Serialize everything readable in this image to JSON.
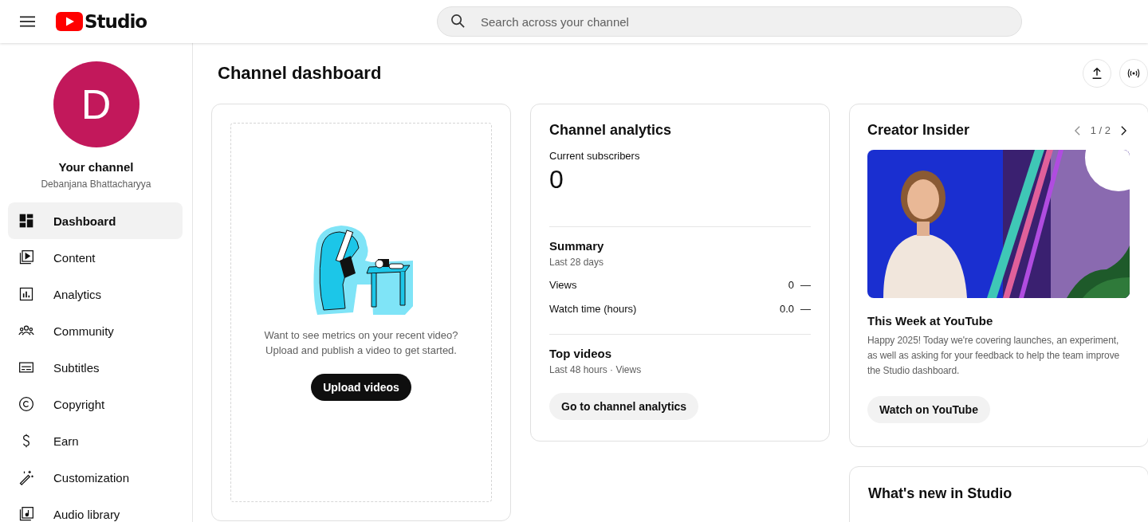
{
  "header": {
    "logo_text": "Studio",
    "search": {
      "placeholder": "Search across your channel"
    }
  },
  "sidebar": {
    "avatar_letter": "D",
    "channel_title": "Your channel",
    "channel_name": "Debanjana Bhattacharyya",
    "items": [
      {
        "label": "Dashboard",
        "selected": true
      },
      {
        "label": "Content",
        "selected": false
      },
      {
        "label": "Analytics",
        "selected": false
      },
      {
        "label": "Community",
        "selected": false
      },
      {
        "label": "Subtitles",
        "selected": false
      },
      {
        "label": "Copyright",
        "selected": false
      },
      {
        "label": "Earn",
        "selected": false
      },
      {
        "label": "Customization",
        "selected": false
      },
      {
        "label": "Audio library",
        "selected": false
      }
    ]
  },
  "page_title": "Channel dashboard",
  "upload_card": {
    "message": [
      "Want to see metrics on your recent video?",
      "Upload and publish a video to get started."
    ],
    "button": "Upload videos"
  },
  "analytics_card": {
    "title": "Channel analytics",
    "subscribers_label": "Current subscribers",
    "subscribers": "0",
    "summary": {
      "title": "Summary",
      "period": "Last 28 days",
      "rows": [
        {
          "label": "Views",
          "value": "0",
          "trend": "—"
        },
        {
          "label": "Watch time (hours)",
          "value": "0.0",
          "trend": "—"
        }
      ]
    },
    "top_videos": {
      "title": "Top videos",
      "period": "Last 48 hours · Views"
    },
    "button": "Go to channel analytics"
  },
  "insider_card": {
    "title": "Creator Insider",
    "pager": "1 / 2",
    "video_title": "This Week at YouTube",
    "description": "Happy 2025! Today we're covering launches, an experiment, as well as asking for your feedback to help the team improve the Studio dashboard.",
    "button": "Watch on YouTube"
  },
  "whats_new_card": {
    "title": "What's new in Studio"
  }
}
